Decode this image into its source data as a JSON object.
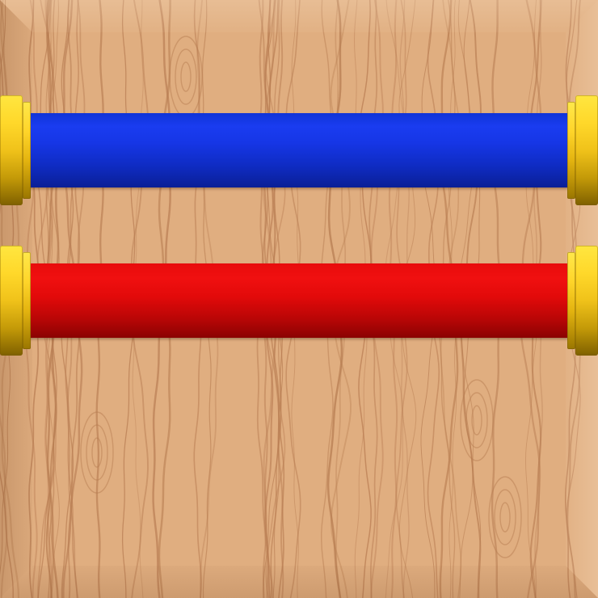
{
  "board": {
    "background_color": "#e0ae80",
    "grain_color": "#b87d52",
    "frame_style": "beveled-wood"
  },
  "rods": [
    {
      "id": "blue",
      "color": "#1a3cf0",
      "shade_color": "#0a1f96",
      "cap_color": "#ffd82a"
    },
    {
      "id": "red",
      "color": "#f01010",
      "shade_color": "#8a0202",
      "cap_color": "#ffd82a"
    }
  ]
}
